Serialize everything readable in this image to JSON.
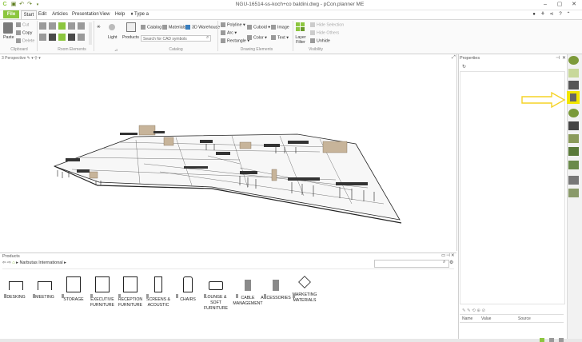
{
  "app": {
    "title": "NGU-16514-ss-koch+co baldini.dwg - pCon.planner ME"
  },
  "tabs": [
    "File",
    "Start",
    "Edit",
    "Articles",
    "Presentation",
    "View",
    "Help"
  ],
  "command_placeholder": "Type a command",
  "ribbon": {
    "clipboard": {
      "paste": "Paste",
      "cut": "Cut",
      "copy": "Copy",
      "delete": "Delete",
      "label": "Clipboard"
    },
    "room_elements": {
      "label": "Room Elements"
    },
    "light": "Light",
    "products": "Products",
    "catalog": {
      "catalog": "Catalog",
      "materials": "Materials",
      "warehouse": "3D Warehouse",
      "search_placeholder": "Search for CAD symbols",
      "label": "Catalog"
    },
    "drawing": {
      "polyline": "Polyline",
      "arc": "Arc",
      "rectangle": "Rectangle",
      "cuboid": "Cuboid",
      "image": "Image",
      "color": "Color",
      "text": "Text",
      "label": "Drawing Elements"
    },
    "visibility": {
      "layer_filter": "Layer Filter",
      "hide_selection": "Hide Selection",
      "hide_others": "Hide Others",
      "unhide": "Unhide",
      "label": "Visibility"
    }
  },
  "viewport": {
    "label": "3 Perspective"
  },
  "properties": {
    "title": "Properties",
    "columns": [
      "Name",
      "Value",
      "Source"
    ]
  },
  "products_panel": {
    "title": "Products",
    "breadcrumb": "Narbutas International",
    "categories": [
      {
        "label": "DESKING",
        "icon": "desk-icon"
      },
      {
        "label": "MEETING",
        "icon": "meeting-table-icon"
      },
      {
        "label": "STORAGE",
        "icon": "storage-cabinet-icon"
      },
      {
        "label": "EXECUTIVE FURNITURE",
        "icon": "executive-desk-icon"
      },
      {
        "label": "RECEPTION FURNITURE",
        "icon": "reception-desk-icon"
      },
      {
        "label": "SCREENS & ACOUSTIC",
        "icon": "screen-panel-icon"
      },
      {
        "label": "CHAIRS",
        "icon": "chair-icon"
      },
      {
        "label": "LOUNGE & SOFT FURNITURE",
        "icon": "sofa-icon"
      },
      {
        "label": "CABLE MANAGEMENT",
        "icon": "cable-tray-icon"
      },
      {
        "label": "ACCESSORIES",
        "icon": "accessory-icon"
      },
      {
        "label": "MARKETING MATERIALS",
        "icon": "layers-icon"
      }
    ]
  },
  "colors": {
    "accent": "#8cc63f",
    "highlight": "#f2e600",
    "arrow": "#f5d327"
  }
}
